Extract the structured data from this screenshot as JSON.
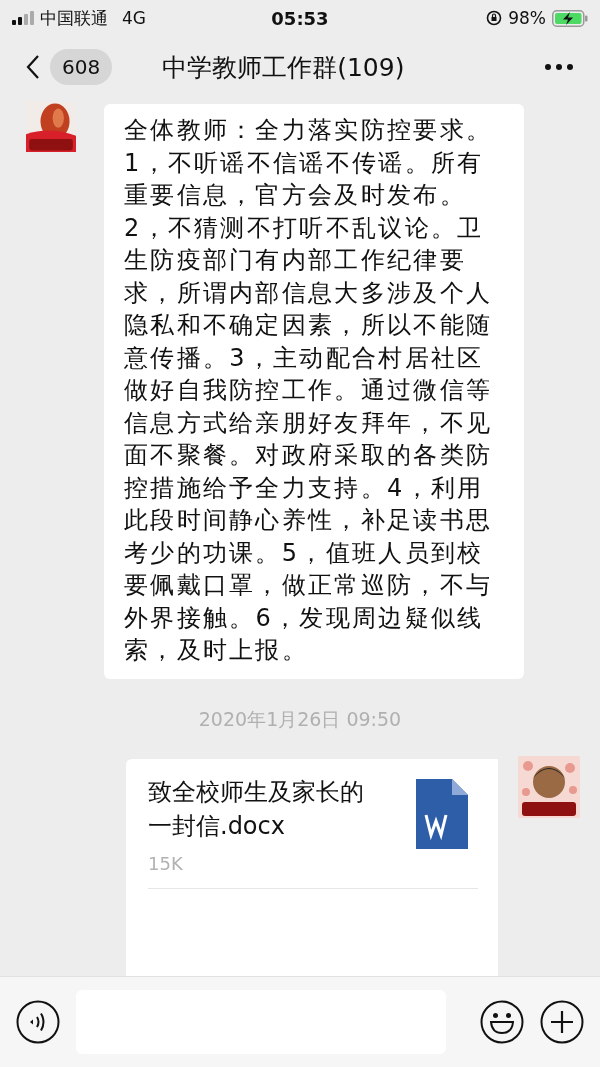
{
  "status_bar": {
    "carrier": "中国联通",
    "network": "4G",
    "time": "05:53",
    "battery": "98%",
    "charging": true
  },
  "nav": {
    "back_count": "608",
    "title": "中学教师工作群(109)"
  },
  "messages": [
    {
      "kind": "text",
      "outgoing": false,
      "text": "全体教师：全力落实防控要求。1，不听谣不信谣不传谣。所有重要信息，官方会及时发布。2，不猜测不打听不乱议论。卫生防疫部门有内部工作纪律要求，所谓内部信息大多涉及个人隐私和不确定因素，所以不能随意传播。3，主动配合村居社区做好自我防控工作。通过微信等信息方式给亲朋好友拜年，不见面不聚餐。对政府采取的各类防控措施给予全力支持。4，利用此段时间静心养性，补足读书思考少的功课。5，值班人员到校要佩戴口罩，做正常巡防，不与外界接触。6，发现周边疑似线索，及时上报。"
    },
    {
      "kind": "timestamp",
      "text": "2020年1月26日 09:50"
    },
    {
      "kind": "file",
      "outgoing": true,
      "file_name": "致全校师生及家长的一封信.docx",
      "size": "15K"
    }
  ]
}
